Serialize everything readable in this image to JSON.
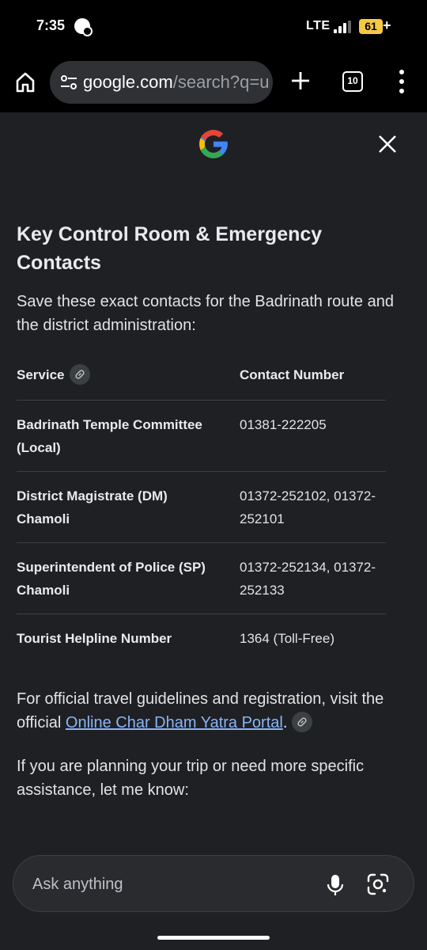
{
  "status_bar": {
    "time": "7:35",
    "network": "LTE",
    "battery": "61",
    "charging": "+"
  },
  "browser": {
    "url_domain": "google.com",
    "url_path": "/search?q=u",
    "tab_count": "10"
  },
  "content": {
    "heading": "Key Control Room & Emergency Contacts",
    "intro": "Save these exact contacts for the Badrinath route and the district administration:",
    "table": {
      "headers": [
        "Service",
        "Contact Number"
      ],
      "rows": [
        {
          "service": "Badrinath Temple Committee (Local)",
          "contact": "01381-222205"
        },
        {
          "service": "District Magistrate (DM) Chamoli",
          "contact": "01372-252102, 01372-252101"
        },
        {
          "service": "Superintendent of Police (SP) Chamoli",
          "contact": "01372-252134, 01372-252133"
        },
        {
          "service": "Tourist Helpline Number",
          "contact": "1364 (Toll-Free)"
        }
      ]
    },
    "footer_prefix": "For official travel guidelines and registration, visit the official ",
    "footer_link": "Online Char Dham Yatra Portal",
    "footer_suffix": ".",
    "closing": "If you are planning your trip or need more specific assistance, let me know:"
  },
  "ask_bar": {
    "placeholder": "Ask anything"
  },
  "colors": {
    "panel_bg": "#1f2023",
    "link": "#8ab4f8",
    "battery": "#f6c944"
  }
}
